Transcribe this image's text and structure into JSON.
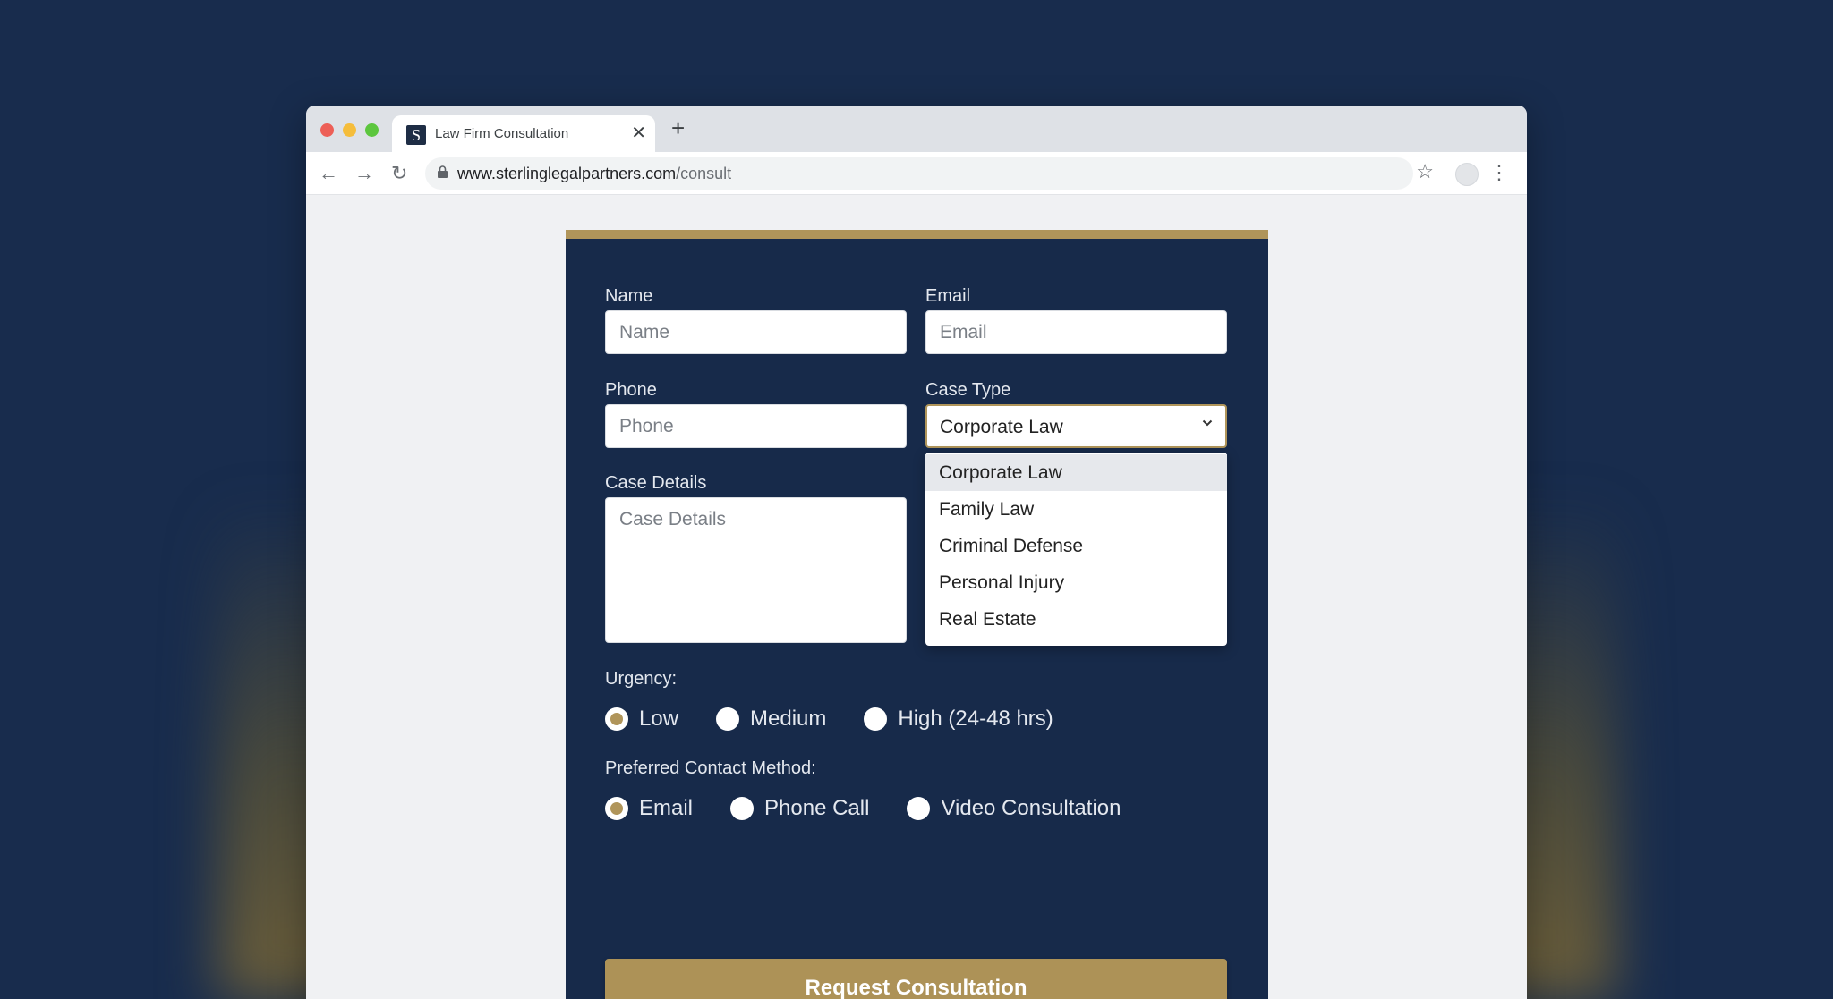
{
  "browser": {
    "tab_title": "Law Firm Consultation",
    "tab_favicon": "S",
    "url_domain": "www.sterlinglegalpartners.com",
    "url_path": "/consult"
  },
  "form": {
    "name_label": "Name",
    "name_placeholder": "Name",
    "email_label": "Email",
    "email_placeholder": "Email",
    "phone_label": "Phone",
    "phone_placeholder": "Phone",
    "case_type_label": "Case Type",
    "case_type_value": "Corporate Law",
    "case_type_options": [
      "Corporate Law",
      "Family Law",
      "Criminal Defense",
      "Personal Injury",
      "Real Estate"
    ],
    "details_label": "Case Details",
    "details_placeholder": "Case Details",
    "urgency_label": "Urgency:",
    "urgency_options": [
      "Low",
      "Medium",
      "High (24-48 hrs)"
    ],
    "urgency_selected": "Low",
    "contact_label": "Preferred Contact Method:",
    "contact_options": [
      "Email",
      "Phone Call",
      "Video Consultation"
    ],
    "contact_selected": "Email",
    "submit_label": "Request Consultation"
  },
  "colors": {
    "page_bg": "#182c4d",
    "card_bg": "#172a4a",
    "accent_gold": "#b0955a"
  }
}
